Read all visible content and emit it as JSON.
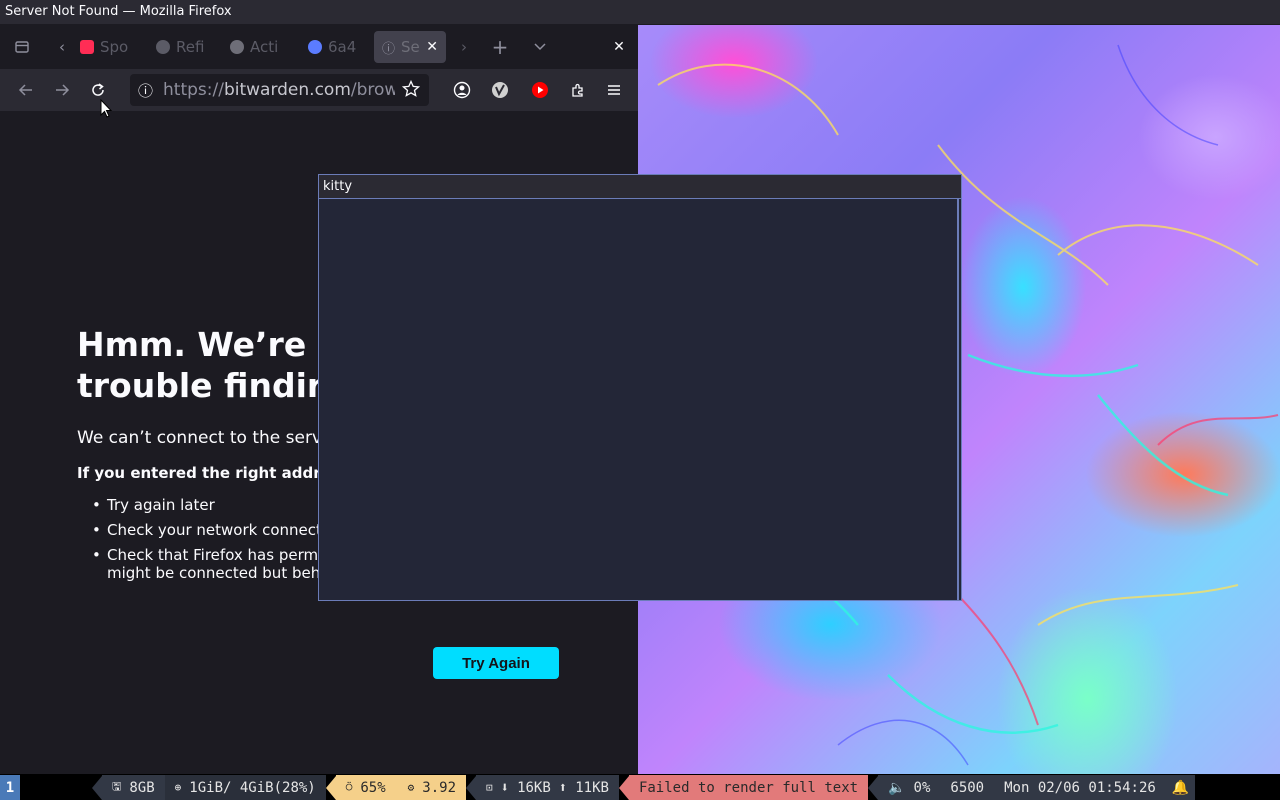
{
  "window": {
    "title": "Server Not Found — Mozilla Firefox"
  },
  "tabs": [
    {
      "label": "Spo",
      "favicon_color": "#ff2d55"
    },
    {
      "label": "Refi",
      "favicon_color": "#8f8f9d"
    },
    {
      "label": "Acti",
      "favicon_color": "#8f8f9d"
    },
    {
      "label": "6a4",
      "favicon_color": "#5b7cff"
    },
    {
      "label": "Se",
      "favicon_color": "#8f8f9d",
      "active": true
    }
  ],
  "navbar": {
    "url_prefix": "https://",
    "url_host": "bitwarden.com",
    "url_path": "/brow"
  },
  "error_page": {
    "title": "Hmm. We’re having trouble finding that site.",
    "title_visible_line1": "Hmm. We’re l",
    "title_visible_line2": "trouble findir",
    "description": "We can’t connect to the serv",
    "subheading": "If you entered the right addr",
    "suggestions": [
      "Try again later",
      "Check your network connect",
      "Check that Firefox has permi might be connected but beh"
    ],
    "try_again_label": "Try Again"
  },
  "kitty": {
    "title": "kitty"
  },
  "statusbar": {
    "workspace": "1",
    "ram": "8GB",
    "memory": "1GiB/ 4GiB(28%)",
    "cpu": "65%",
    "load": "3.92",
    "net_down": "16KB",
    "net_up": "11KB",
    "message": "Failed to render full text",
    "volume": "0%",
    "temperature": "6500",
    "datetime": "Mon 02/06 01:54:26"
  },
  "colors": {
    "accent": "#00ddff",
    "kitty_border": "#6b7cb8",
    "status_yellow": "#f5d08a",
    "status_red": "#e27a7a"
  }
}
